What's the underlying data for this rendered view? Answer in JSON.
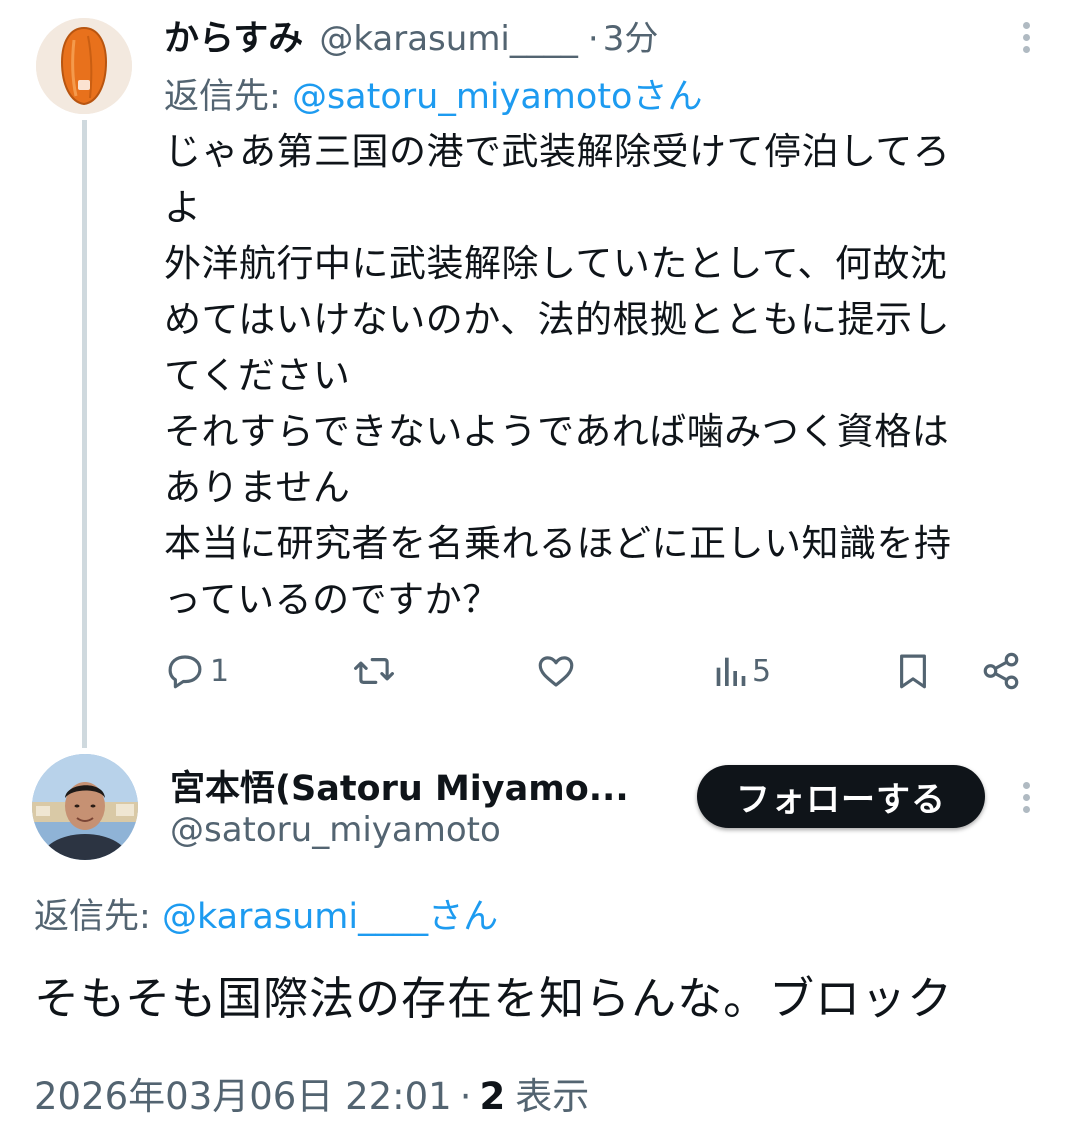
{
  "reply_tweet": {
    "display_name": "からすみ",
    "handle": "@karasumi____",
    "separator": "·",
    "time": "3分",
    "reply_to_label": "返信先:",
    "reply_to_handle": "@satoru_miyamotoさん",
    "text_lines": [
      "じゃあ第三国の港で武装解除受けて停泊してろ",
      "よ",
      "外洋航行中に武装解除していたとして、何故沈",
      "めてはいけないのか、法的根拠とともに提示し",
      "てください",
      "それすらできないようであれば噛みつく資格は",
      "ありません",
      "本当に研究者を名乗れるほどに正しい知識を持",
      "っているのですか？"
    ],
    "actions": {
      "reply_count": "1",
      "retweet_count": "",
      "like_count": "",
      "views_count": "5"
    },
    "icons": [
      "reply-icon",
      "retweet-icon",
      "heart-icon",
      "views-icon",
      "bookmark-icon",
      "share-icon",
      "more-icon"
    ]
  },
  "main_tweet": {
    "display_name": "宮本悟(Satoru Miyamo...",
    "handle": "@satoru_miyamoto",
    "follow_label": "フォローする",
    "reply_to_label": "返信先:",
    "reply_to_handle": "@karasumi____さん",
    "text": "そもそも国際法の存在を知らんな。ブロック",
    "timestamp": "2026年03月06日 22:01",
    "separator": "·",
    "views_count": "2",
    "views_label": "表示"
  },
  "colors": {
    "text": "#0f1419",
    "muted": "#536471",
    "link": "#1d9bf0",
    "thread_line": "#cfd9de",
    "follow_bg": "#0f1419"
  }
}
